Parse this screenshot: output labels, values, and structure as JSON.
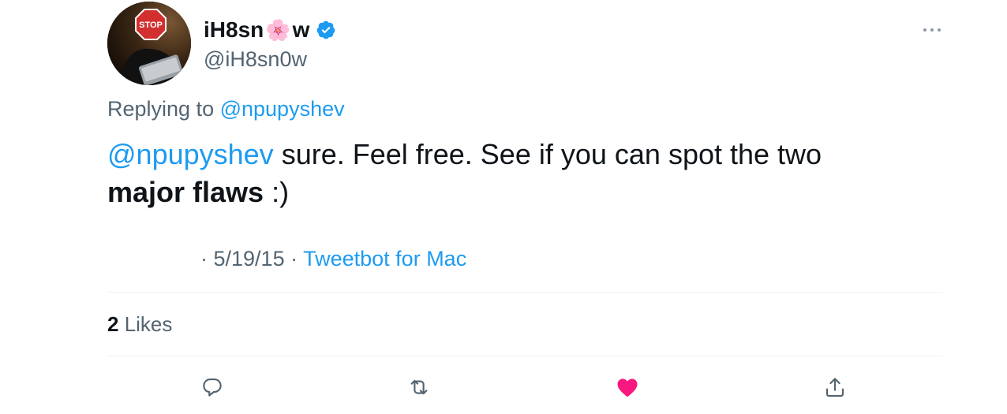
{
  "author": {
    "display_name_part1": "iH8sn",
    "display_name_flower": "🌸",
    "display_name_part2": "w",
    "handle": "@iH8sn0w",
    "verified": true,
    "avatar_sign_text": "STOP"
  },
  "reply_context": {
    "prefix": "Replying to ",
    "mention": "@npupyshev"
  },
  "tweet": {
    "mention": "@npupyshev",
    "text_plain": " sure. Feel free. See if you can spot the two ",
    "text_bold": "major flaws",
    "text_end": " :)"
  },
  "meta": {
    "separator_1": "· ",
    "date": "5/19/15",
    "separator_2": " · ",
    "source": "Tweetbot for Mac"
  },
  "stats": {
    "likes_count": "2",
    "likes_label": " Likes"
  },
  "colors": {
    "accent": "#1d9bf0",
    "like_active": "#f91880",
    "secondary_text": "#536471",
    "primary_text": "#0f1419"
  },
  "actions": [
    {
      "name": "reply",
      "icon": "reply-icon"
    },
    {
      "name": "retweet",
      "icon": "retweet-icon"
    },
    {
      "name": "like",
      "icon": "heart-icon",
      "active": true
    },
    {
      "name": "share",
      "icon": "share-icon"
    }
  ]
}
